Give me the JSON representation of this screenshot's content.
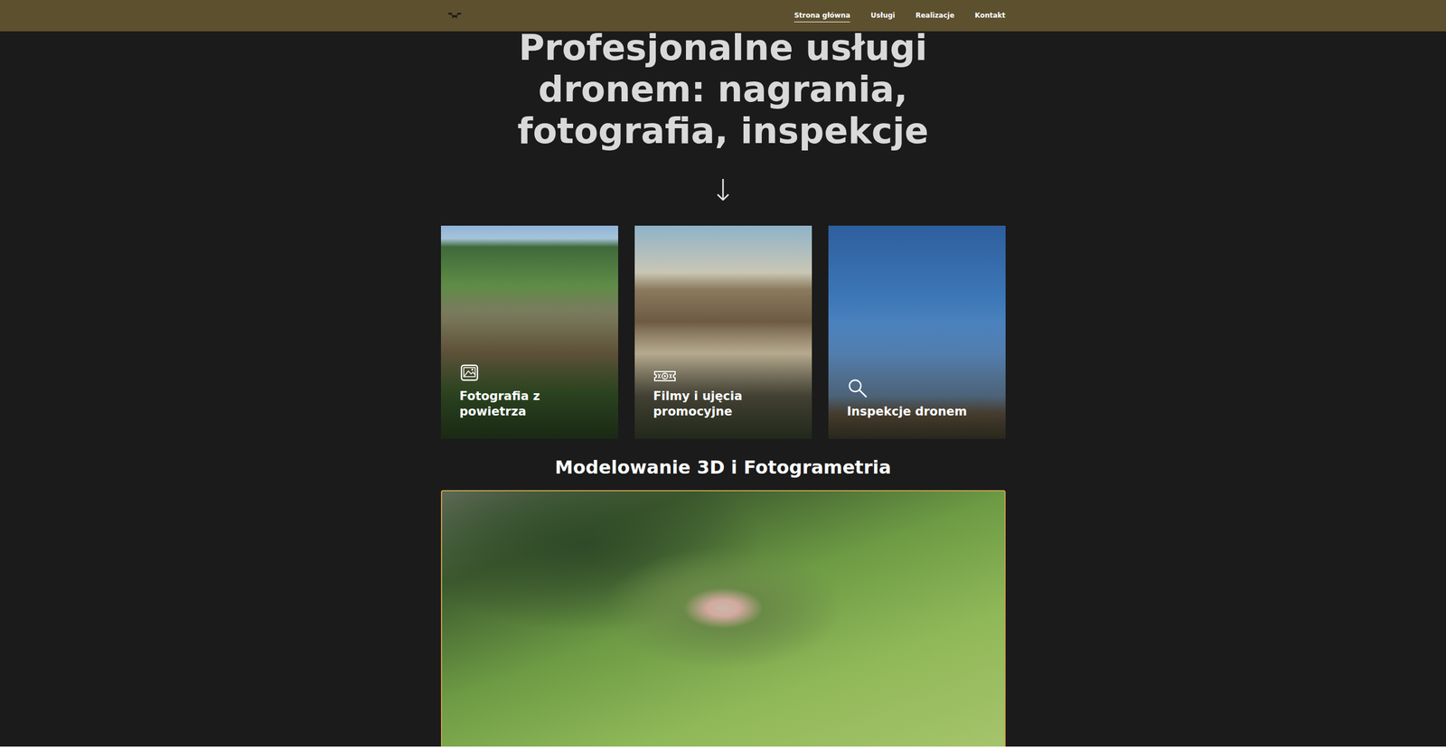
{
  "nav": {
    "links": [
      {
        "label": "Strona główna",
        "selected": true
      },
      {
        "label": "Usługi",
        "selected": false
      },
      {
        "label": "Realizacje",
        "selected": false
      },
      {
        "label": "Kontakt",
        "selected": false
      }
    ]
  },
  "hero": {
    "title_lines": [
      "Profesjonalne usługi",
      "dronem: nagrania,",
      "fotografia, inspekcje"
    ],
    "arrow": "↓"
  },
  "cards": [
    {
      "title": "Fotografia z powietrza",
      "kind": "photo"
    },
    {
      "title": "Filmy i ujęcia promocyjne",
      "kind": "video"
    },
    {
      "title": "Inspekcje dronem",
      "kind": "inspection"
    }
  ],
  "section": {
    "title": "Modelowanie 3D i Fotogrametria"
  }
}
